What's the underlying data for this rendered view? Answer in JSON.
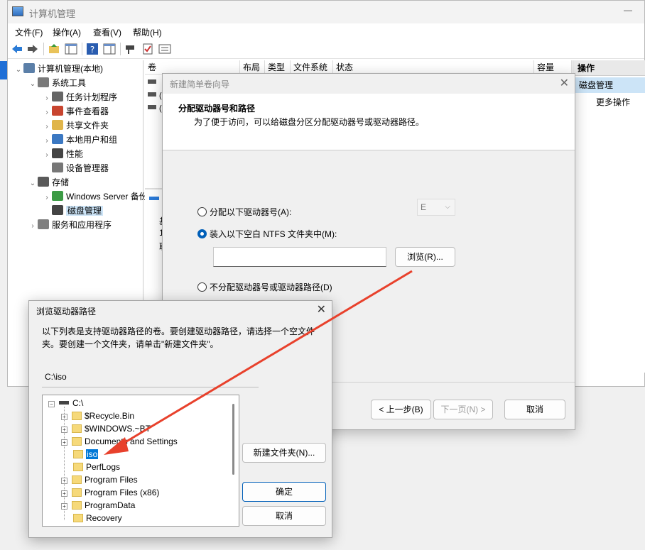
{
  "main_window": {
    "title": "计算机管理",
    "menu": [
      "文件(F)",
      "操作(A)",
      "查看(V)",
      "帮助(H)"
    ]
  },
  "tree": [
    {
      "label": "计算机管理(本地)",
      "indent": 0,
      "exp": "⌄"
    },
    {
      "label": "系统工具",
      "indent": 1,
      "exp": "⌄"
    },
    {
      "label": "任务计划程序",
      "indent": 2,
      "exp": "›"
    },
    {
      "label": "事件查看器",
      "indent": 2,
      "exp": "›"
    },
    {
      "label": "共享文件夹",
      "indent": 2,
      "exp": "›"
    },
    {
      "label": "本地用户和组",
      "indent": 2,
      "exp": "›"
    },
    {
      "label": "性能",
      "indent": 2,
      "exp": "›"
    },
    {
      "label": "设备管理器",
      "indent": 2,
      "exp": ""
    },
    {
      "label": "存储",
      "indent": 1,
      "exp": "⌄"
    },
    {
      "label": "Windows Server 备份",
      "indent": 2,
      "exp": "›"
    },
    {
      "label": "磁盘管理",
      "indent": 2,
      "exp": "",
      "selected": true
    },
    {
      "label": "服务和应用程序",
      "indent": 1,
      "exp": "›"
    }
  ],
  "columns": [
    "卷",
    "布局",
    "类型",
    "文件系统",
    "状态",
    "容量"
  ],
  "disk_info": {
    "line1": "基",
    "line2": "10",
    "line3": "联"
  },
  "actions": {
    "header": "操作",
    "selected": "磁盘管理",
    "more": "更多操作"
  },
  "wizard": {
    "title": "新建简单卷向导",
    "heading": "分配驱动器号和路径",
    "subheading": "为了便于访问，可以给磁盘分区分配驱动器号或驱动器路径。",
    "option_letter": "分配以下驱动器号(A):",
    "letter_value": "E",
    "option_folder": "装入以下空白 NTFS 文件夹中(M):",
    "browse_button": "浏览(R)...",
    "option_none": "不分配驱动器号或驱动器路径(D)",
    "back_button": "< 上一步(B)",
    "next_button": "下一页(N) >",
    "cancel_button": "取消"
  },
  "browse": {
    "title": "浏览驱动器路径",
    "description": "以下列表是支持驱动器路径的卷。要创建驱动器路径，请选择一个空文件夹。要创建一个文件夹，请单击\"新建文件夹\"。",
    "path": "C:\\iso",
    "root": "C:\\",
    "items": [
      {
        "name": "$Recycle.Bin",
        "expand": true
      },
      {
        "name": "$WINDOWS.~BT",
        "expand": true
      },
      {
        "name": "Documents and Settings",
        "expand": true
      },
      {
        "name": "iso",
        "expand": false,
        "selected": true
      },
      {
        "name": "PerfLogs",
        "expand": false
      },
      {
        "name": "Program Files",
        "expand": true
      },
      {
        "name": "Program Files (x86)",
        "expand": true
      },
      {
        "name": "ProgramData",
        "expand": true
      },
      {
        "name": "Recovery",
        "expand": false
      }
    ],
    "new_folder_button": "新建文件夹(N)...",
    "ok_button": "确定",
    "cancel_button": "取消"
  },
  "annotation_color": "#e8412c"
}
